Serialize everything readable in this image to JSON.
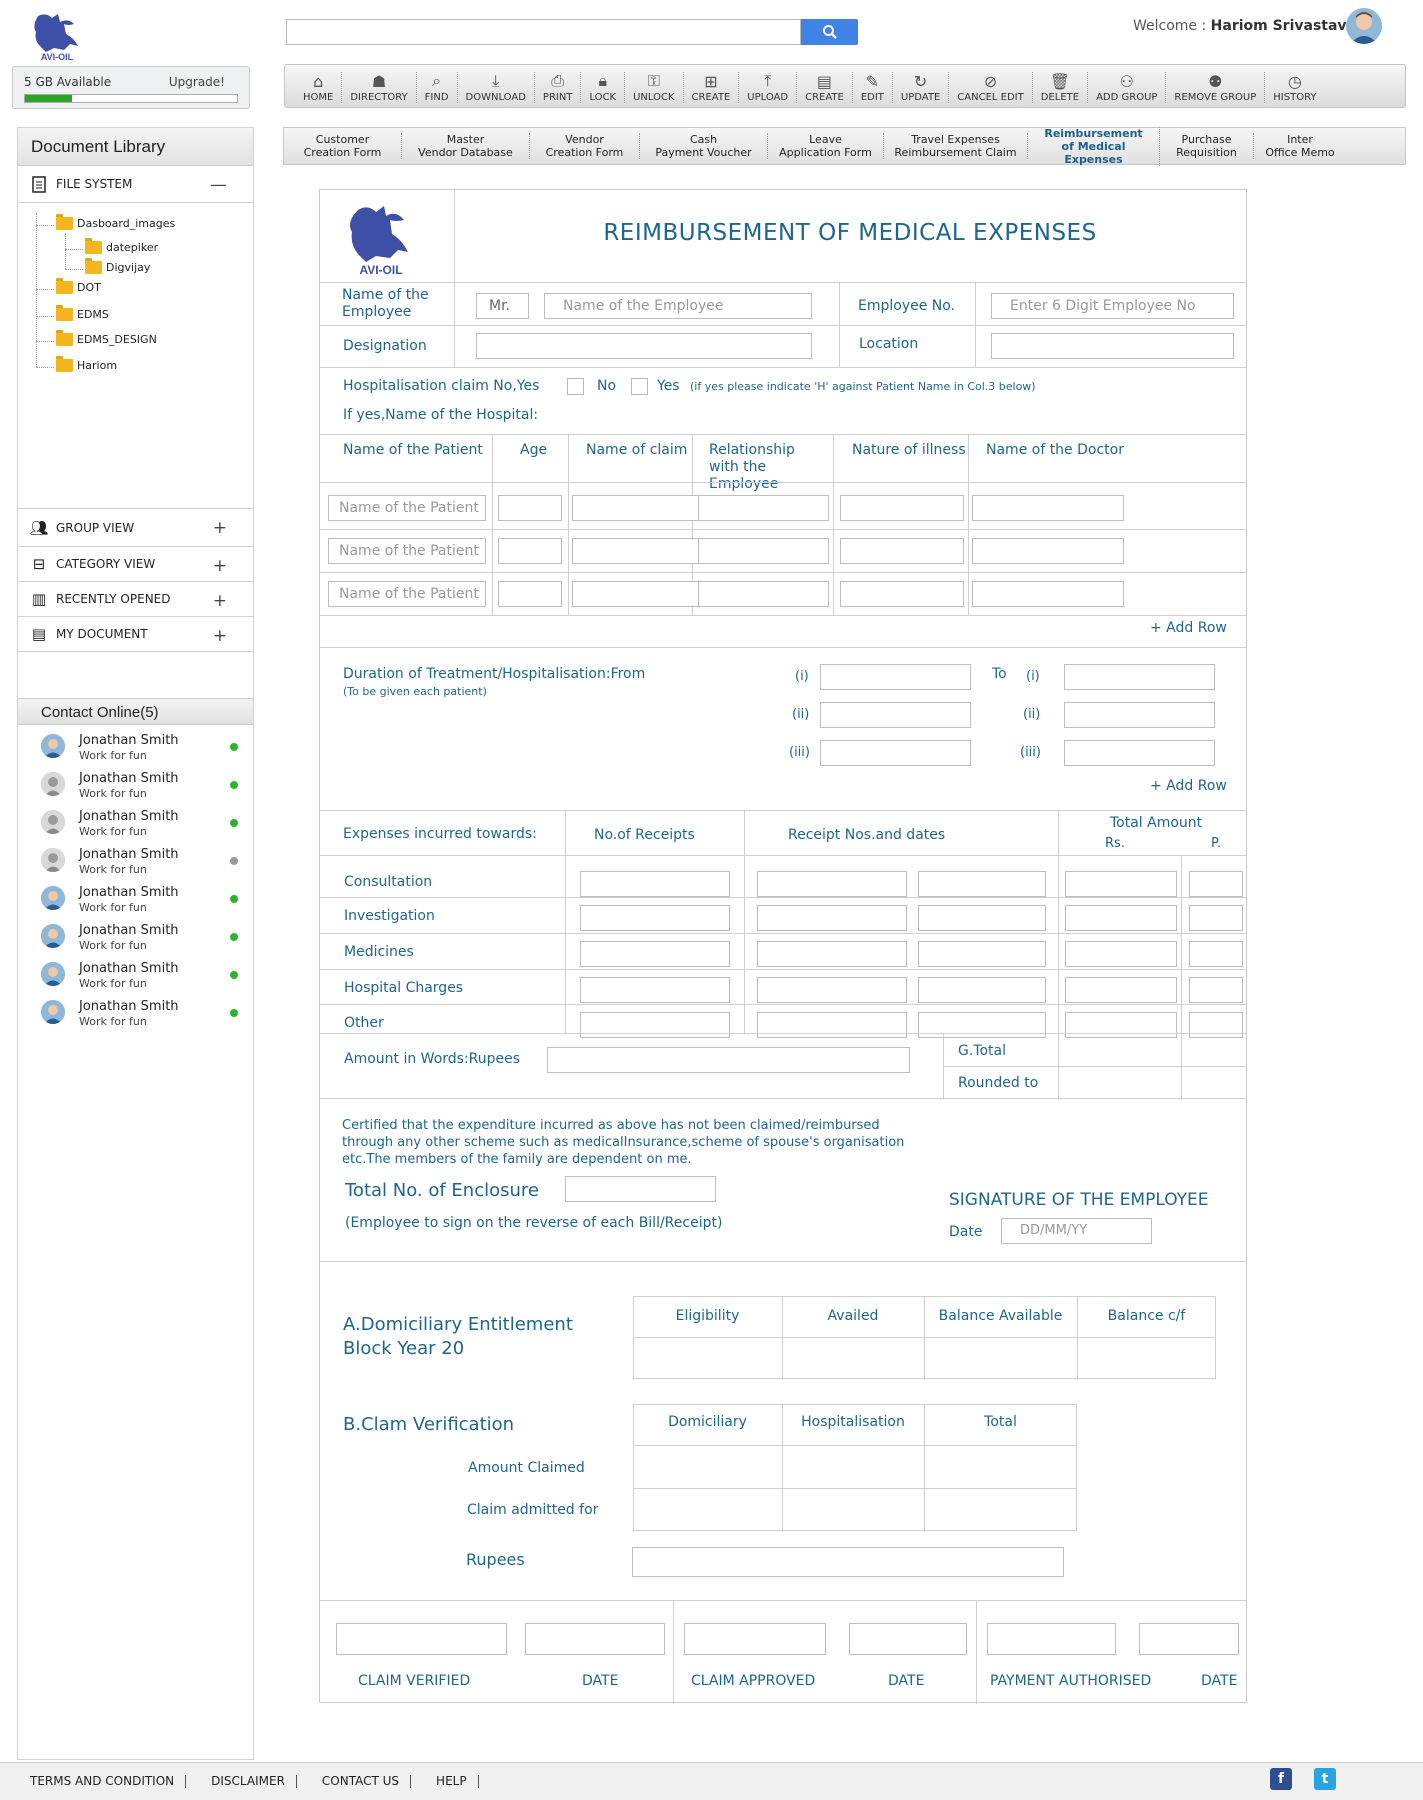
{
  "header": {
    "logo_text": "AVI-OIL",
    "search_placeholder": "",
    "welcome_prefix": "Welcome : ",
    "user_name": "Hariom Srivastava"
  },
  "storage": {
    "label": "5 GB Available",
    "upgrade": "Upgrade!",
    "used_fraction": 0.22
  },
  "toolbar": [
    {
      "label": "HOME",
      "icon": "home-icon"
    },
    {
      "label": "DIRECTORY",
      "icon": "directory-icon"
    },
    {
      "label": "FIND",
      "icon": "find-icon"
    },
    {
      "label": "DOWNLOAD",
      "icon": "download-icon"
    },
    {
      "label": "PRINT",
      "icon": "print-icon"
    },
    {
      "label": "LOCK",
      "icon": "lock-icon"
    },
    {
      "label": "UNLOCK",
      "icon": "unlock-icon"
    },
    {
      "label": "CREATE",
      "icon": "create-folder-icon"
    },
    {
      "label": "UPLOAD",
      "icon": "upload-icon"
    },
    {
      "label": "CREATE",
      "icon": "create-doc-icon"
    },
    {
      "label": "EDIT",
      "icon": "edit-icon"
    },
    {
      "label": "UPDATE",
      "icon": "update-icon"
    },
    {
      "label": "CANCEL EDIT",
      "icon": "cancel-edit-icon"
    },
    {
      "label": "DELETE",
      "icon": "delete-icon"
    },
    {
      "label": "ADD GROUP",
      "icon": "add-group-icon"
    },
    {
      "label": "REMOVE GROUP",
      "icon": "remove-group-icon"
    },
    {
      "label": "HISTORY",
      "icon": "history-icon"
    }
  ],
  "tabs": [
    {
      "line1": "Customer",
      "line2": "Creation Form"
    },
    {
      "line1": "Master",
      "line2": "Vendor Database"
    },
    {
      "line1": "Vendor",
      "line2": "Creation Form"
    },
    {
      "line1": "Cash",
      "line2": "Payment Voucher"
    },
    {
      "line1": "Leave",
      "line2": "Application Form"
    },
    {
      "line1": "Travel Expenses",
      "line2": "Reimbursement Claim"
    },
    {
      "line1": "Reimbursement",
      "line2": "of Medical Expenses"
    },
    {
      "line1": "Purchase",
      "line2": "Requisition"
    },
    {
      "line1": "Inter",
      "line2": "Office Memo"
    }
  ],
  "sidebar": {
    "title": "Document Library",
    "file_system": "FILE SYSTEM",
    "tree": [
      "Dasboard_images",
      "datepiker",
      "Digvijay",
      "DOT",
      "EDMS",
      "EDMS_DESIGN",
      "Hariom"
    ],
    "sections": [
      "GROUP VIEW",
      "CATEGORY VIEW",
      "RECENTLY OPENED",
      "MY DOCUMENT"
    ],
    "contacts_title": "Contact Online(5)",
    "contacts": [
      {
        "name": "Jonathan Smith",
        "status": "Work for fun",
        "online": true
      },
      {
        "name": "Jonathan Smith",
        "status": "Work for fun",
        "online": true
      },
      {
        "name": "Jonathan Smith",
        "status": "Work for fun",
        "online": true
      },
      {
        "name": "Jonathan Smith",
        "status": "Work for fun",
        "online": false
      },
      {
        "name": "Jonathan Smith",
        "status": "Work for fun",
        "online": true
      },
      {
        "name": "Jonathan Smith",
        "status": "Work for fun",
        "online": true
      },
      {
        "name": "Jonathan Smith",
        "status": "Work for fun",
        "online": true
      },
      {
        "name": "Jonathan Smith",
        "status": "Work for fun",
        "online": true
      }
    ]
  },
  "form": {
    "title": "REIMBURSEMENT OF MEDICAL EXPENSES",
    "name_label": "Name of the Employee",
    "title_value": "Mr.",
    "name_placeholder": "Name of the Employee",
    "emp_no_label": "Employee No.",
    "emp_no_placeholder": "Enter 6 Digit Employee No",
    "designation_label": "Designation",
    "location_label": "Location",
    "hosp_claim_label": "Hospitalisation claim No,Yes",
    "no_label": "No",
    "yes_label": "Yes",
    "yes_note": "(if yes  please indicate 'H' against Patient Name in Col.3 below)",
    "hospital_name_label": "If yes,Name of the Hospital:",
    "patient_cols": [
      "Name of the Patient",
      "Age",
      "Name of claim",
      "Relationship with the Employee",
      "Nature of illness",
      "Name of the Doctor"
    ],
    "patient_placeholder": "Name of the Patient",
    "add_row": "+ Add Row",
    "duration_label": "Duration of Treatment/Hospitalisation:From",
    "duration_note": "(To be given each patient)",
    "to_label": "To",
    "romans": [
      "(i)",
      "(ii)",
      "(iii)"
    ],
    "expenses_label": "Expenses incurred towards:",
    "receipts_col": "No.of Receipts",
    "receipt_nos_col": "Receipt Nos.and dates",
    "total_col": "Total Amount",
    "rs": "Rs.",
    "p": "P.",
    "expense_rows": [
      "Consultation",
      "Investigation",
      "Medicines",
      "Hospital Charges",
      "Other"
    ],
    "amount_words": "Amount in Words:Rupees",
    "gtotal": "G.Total",
    "rounded": "Rounded to",
    "certify": [
      "Certified that the expenditure incurred as above has not been claimed/reimbursed",
      "through any other scheme such as medicalInsurance,scheme of spouse's organisation",
      "etc.The members of the family are dependent on me."
    ],
    "enclosure": "Total No. of Enclosure",
    "sign_note": "(Employee to sign on the reverse of each Bill/Receipt)",
    "signature": "SIGNATURE OF THE EMPLOYEE",
    "date_label": "Date",
    "date_placeholder": "DD/MM/YY",
    "domiciliary_title_1": "A.Domiciliary Entitlement",
    "domiciliary_title_2": "Block Year 20",
    "domiciliary_cols": [
      "Eligibility",
      "Availed",
      "Balance Available",
      "Balance c/f"
    ],
    "claim_title": "B.Clam Verification",
    "claim_cols": [
      "Domiciliary",
      "Hospitalisation",
      "Total"
    ],
    "amount_claimed": "Amount Claimed",
    "claim_admitted": "Claim admitted for",
    "rupees": "Rupees",
    "sign_blocks": [
      {
        "left": "CLAIM VERIFIED",
        "right": "DATE"
      },
      {
        "left": "CLAIM APPROVED",
        "right": "DATE"
      },
      {
        "left": "PAYMENT AUTHORISED",
        "right": "DATE"
      }
    ]
  },
  "footer": {
    "links": [
      "TERMS AND CONDITION",
      "DISCLAIMER",
      "CONTACT US",
      "HELP"
    ],
    "facebook": "f",
    "twitter": "t"
  },
  "colors": {
    "accent": "#1d6591",
    "search_button": "#3f84e5",
    "online": "#2db42d"
  }
}
